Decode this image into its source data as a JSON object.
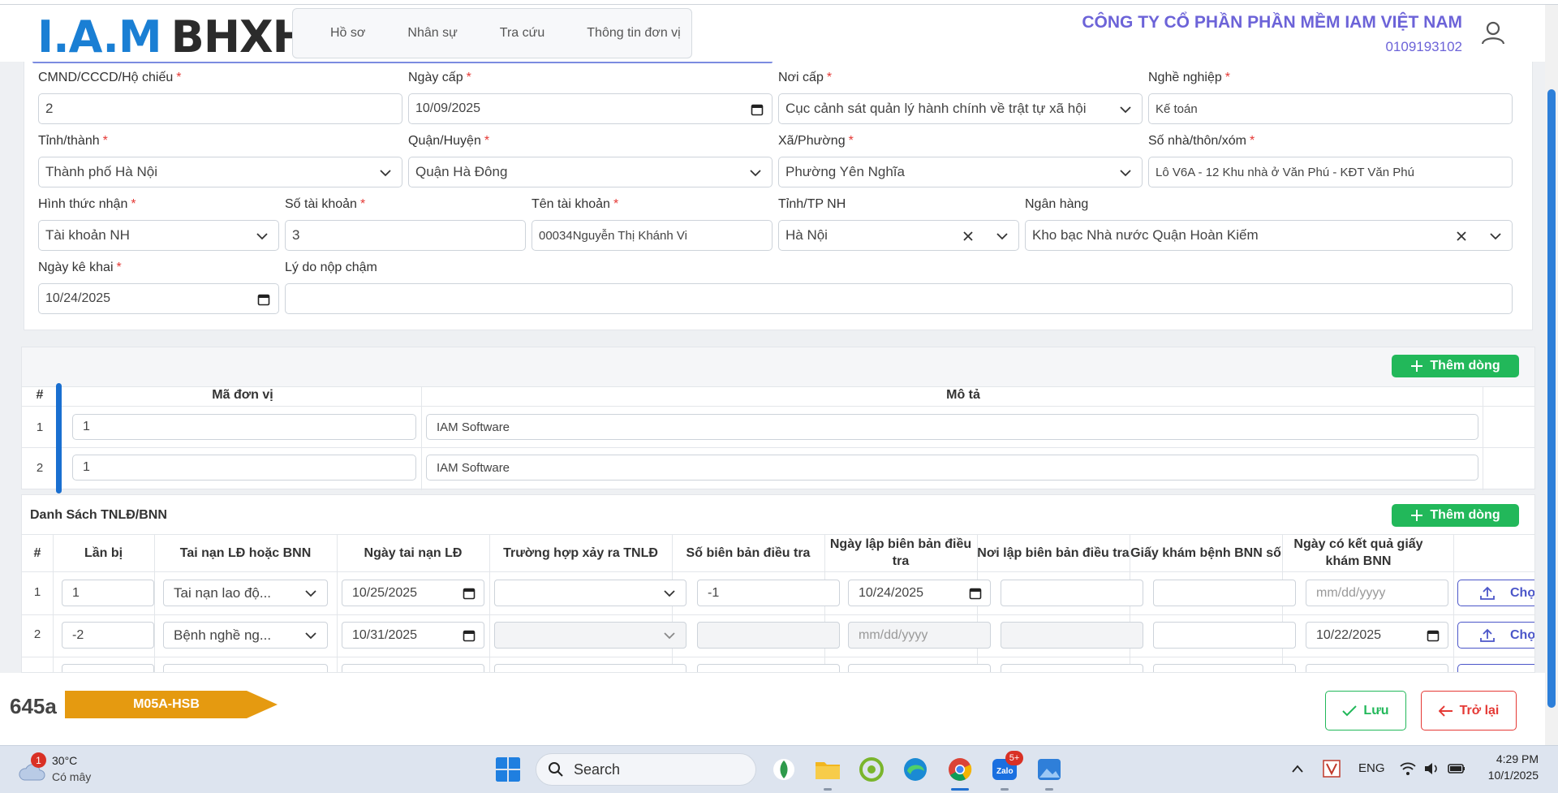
{
  "header": {
    "logo_left": "I.A.M",
    "logo_right": "BHXH",
    "nav": [
      "Hồ sơ",
      "Nhân sự",
      "Tra cứu",
      "Thông tin đơn vị"
    ],
    "company_name": "CÔNG TY CỔ PHẦN PHẦN MỀM IAM VIỆT NAM",
    "tax_code": "0109193102"
  },
  "form": {
    "id_label": "CMND/CCCD/Hộ chiếu",
    "id_value": "2",
    "issue_date_label": "Ngày cấp",
    "issue_date_value": "10/09/2025",
    "issue_place_label": "Nơi cấp",
    "issue_place_value": "Cục cảnh sát quản lý hành chính về trật tự xã hội",
    "job_label": "Nghề nghiệp",
    "job_value": "Kế toán",
    "province_label": "Tỉnh/thành",
    "province_value": "Thành phố Hà Nội",
    "district_label": "Quận/Huyện",
    "district_value": "Quận Hà Đông",
    "ward_label": "Xã/Phường",
    "ward_value": "Phường Yên Nghĩa",
    "address_label": "Số nhà/thôn/xóm",
    "address_value": "Lô V6A - 12 Khu nhà ở Văn Phú - KĐT Văn Phú",
    "receive_label": "Hình thức nhận",
    "receive_value": "Tài khoản NH",
    "account_no_label": "Số tài khoản",
    "account_no_value": "3",
    "account_name_label": "Tên tài khoản",
    "account_name_value": "00034Nguyễn Thị Khánh Vi",
    "bank_province_label": "Tỉnh/TP NH",
    "bank_province_value": "Hà Nội",
    "bank_label": "Ngân hàng",
    "bank_value": "Kho bạc Nhà nước Quận Hoàn Kiếm",
    "declare_date_label": "Ngày kê khai",
    "declare_date_value": "10/24/2025",
    "late_reason_label": "Lý do nộp chậm",
    "late_reason_value": ""
  },
  "units_table": {
    "add_label": "Thêm dòng",
    "headers": [
      "#",
      "Mã đơn vị",
      "Mô tả"
    ],
    "rows": [
      {
        "no": "1",
        "code": "1",
        "desc": "IAM Software"
      },
      {
        "no": "2",
        "code": "1",
        "desc": "IAM Software"
      }
    ]
  },
  "accidents": {
    "title": "Danh Sách TNLĐ/BNN",
    "add_label": "Thêm dòng",
    "headers": [
      "#",
      "Lần bị",
      "Tai nạn LĐ hoặc BNN",
      "Ngày tai nạn LĐ",
      "Trường hợp xảy ra TNLĐ",
      "Số biên bản điều tra",
      "Ngày lập biên bản điều tra",
      "Nơi lập biên bản điều tra",
      "Giấy khám bệnh BNN số",
      "Ngày có kết quả giấy khám BNN"
    ],
    "upload_label": "Chọn",
    "date_placeholder": "mm/dd/yyyy",
    "rows": [
      {
        "no": "1",
        "times": "1",
        "type": "Tai nạn lao độ...",
        "date": "10/25/2025",
        "case": "",
        "report_no": "-1",
        "report_date": "10/24/2025",
        "report_place": "",
        "paper_no": "",
        "result_date": ""
      },
      {
        "no": "2",
        "times": "-2",
        "type": "Bệnh nghề ng...",
        "date": "10/31/2025",
        "case": "",
        "report_no": "",
        "report_date": "",
        "report_place": "",
        "paper_no": "",
        "result_date": "10/22/2025"
      }
    ]
  },
  "footer": {
    "code": "645a",
    "form_tag": "M05A-HSB",
    "save_label": "Lưu",
    "back_label": "Trở lại"
  },
  "taskbar": {
    "weather_temp": "30°C",
    "weather_desc": "Có mây",
    "weather_badge": "1",
    "search_label": "Search",
    "zalo_badge": "5+",
    "lang": "ENG",
    "time": "4:29 PM",
    "date": "10/1/2025"
  }
}
